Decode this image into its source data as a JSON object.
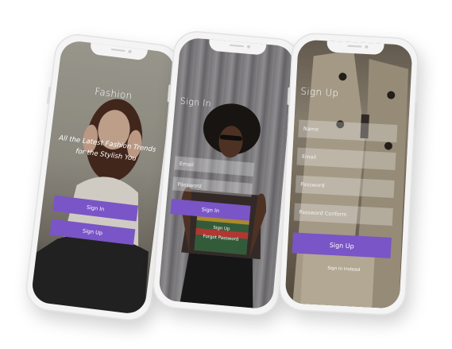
{
  "phones": {
    "fashion": {
      "title": "Fashion",
      "subtitle_line1": "All the Latest Fashion Trends",
      "subtitle_line2": "for the Stylish You",
      "sign_in_label": "Sign In",
      "sign_up_label": "Sign Up"
    },
    "signin": {
      "title": "Sign In",
      "email_placeholder": "Email",
      "password_placeholder": "Password",
      "sign_in_label": "Sign In",
      "sign_up_label": "Sign Up",
      "forgot_label": "Forgot Password"
    },
    "signup": {
      "title": "Sign Up",
      "name_placeholder": "Name",
      "email_placeholder": "Email",
      "password_placeholder": "Password",
      "password_confirm_placeholder": "Password Conform",
      "sign_up_label": "Sign Up",
      "sign_in_instead_label": "Sign In Instead"
    }
  },
  "colors": {
    "accent": "#7a55c7",
    "background": "#ffffff",
    "phone_body": "#f4f4f4"
  }
}
